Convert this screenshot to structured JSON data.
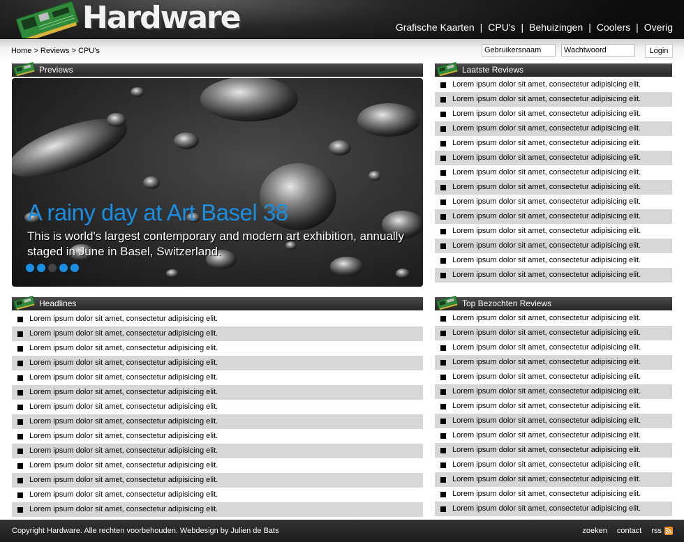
{
  "header": {
    "logo_text": "Hardware",
    "nav": [
      "Grafische Kaarten",
      "CPU's",
      "Behuizingen",
      "Coolers",
      "Overig"
    ],
    "nav_separator": "|"
  },
  "breadcrumb": {
    "home": "Home",
    "sep": " > ",
    "reviews": "Reviews",
    "current": "CPU's"
  },
  "login": {
    "username_placeholder": "Gebruikersnaam",
    "password_placeholder": "Wachtwoord",
    "button": "Login"
  },
  "sections": {
    "previews": "Previews",
    "latest_reviews": "Laatste Reviews",
    "headlines": "Headlines",
    "top_reviews": "Top Bezochten Reviews"
  },
  "slider": {
    "title": "A rainy day at Art Basel 38",
    "description": "This is world's largest contemporary and modern art exhibition, annually staged in June in Basel, Switzerland.",
    "dots": [
      true,
      true,
      false,
      true,
      true
    ],
    "accent": "#1a8ee0"
  },
  "latest_reviews": [
    "Lorem ipsum dolor sit amet, consectetur adipisicing elit.",
    "Lorem ipsum dolor sit amet, consectetur adipisicing elit.",
    "Lorem ipsum dolor sit amet, consectetur adipisicing elit.",
    "Lorem ipsum dolor sit amet, consectetur adipisicing elit.",
    "Lorem ipsum dolor sit amet, consectetur adipisicing elit.",
    "Lorem ipsum dolor sit amet, consectetur adipisicing elit.",
    "Lorem ipsum dolor sit amet, consectetur adipisicing elit.",
    "Lorem ipsum dolor sit amet, consectetur adipisicing elit.",
    "Lorem ipsum dolor sit amet, consectetur adipisicing elit.",
    "Lorem ipsum dolor sit amet, consectetur adipisicing elit.",
    "Lorem ipsum dolor sit amet, consectetur adipisicing elit.",
    "Lorem ipsum dolor sit amet, consectetur adipisicing elit.",
    "Lorem ipsum dolor sit amet, consectetur adipisicing elit.",
    "Lorem ipsum dolor sit amet, consectetur adipisicing elit."
  ],
  "headlines": [
    "Lorem ipsum dolor sit amet, consectetur adipisicing elit.",
    "Lorem ipsum dolor sit amet, consectetur adipisicing elit.",
    "Lorem ipsum dolor sit amet, consectetur adipisicing elit.",
    "Lorem ipsum dolor sit amet, consectetur adipisicing elit.",
    "Lorem ipsum dolor sit amet, consectetur adipisicing elit.",
    "Lorem ipsum dolor sit amet, consectetur adipisicing elit.",
    "Lorem ipsum dolor sit amet, consectetur adipisicing elit.",
    "Lorem ipsum dolor sit amet, consectetur adipisicing elit.",
    "Lorem ipsum dolor sit amet, consectetur adipisicing elit.",
    "Lorem ipsum dolor sit amet, consectetur adipisicing elit.",
    "Lorem ipsum dolor sit amet, consectetur adipisicing elit.",
    "Lorem ipsum dolor sit amet, consectetur adipisicing elit.",
    "Lorem ipsum dolor sit amet, consectetur adipisicing elit.",
    "Lorem ipsum dolor sit amet, consectetur adipisicing elit."
  ],
  "top_reviews": [
    "Lorem ipsum dolor sit amet, consectetur adipisicing elit.",
    "Lorem ipsum dolor sit amet, consectetur adipisicing elit.",
    "Lorem ipsum dolor sit amet, consectetur adipisicing elit.",
    "Lorem ipsum dolor sit amet, consectetur adipisicing elit.",
    "Lorem ipsum dolor sit amet, consectetur adipisicing elit.",
    "Lorem ipsum dolor sit amet, consectetur adipisicing elit.",
    "Lorem ipsum dolor sit amet, consectetur adipisicing elit.",
    "Lorem ipsum dolor sit amet, consectetur adipisicing elit.",
    "Lorem ipsum dolor sit amet, consectetur adipisicing elit.",
    "Lorem ipsum dolor sit amet, consectetur adipisicing elit.",
    "Lorem ipsum dolor sit amet, consectetur adipisicing elit.",
    "Lorem ipsum dolor sit amet, consectetur adipisicing elit.",
    "Lorem ipsum dolor sit amet, consectetur adipisicing elit.",
    "Lorem ipsum dolor sit amet, consectetur adipisicing elit."
  ],
  "footer": {
    "copyright": "Copyright  Hardware. Alle rechten voorbehouden. Webdesign by Julien de Bats",
    "links": [
      "zoeken",
      "contact",
      "rss"
    ],
    "rss_icon": "rss-feed-icon"
  }
}
